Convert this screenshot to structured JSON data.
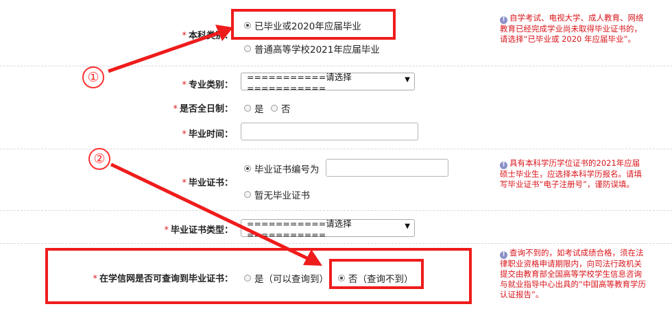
{
  "form": {
    "required_mark": "*",
    "rows": {
      "degree_type": {
        "label": "本科类别：",
        "options": [
          "已毕业或2020年应届毕业",
          "普通高等学校2021年应届毕业"
        ],
        "selected_index": 0,
        "hint": "自学考试、电视大学、成人教育、网络教育已经完成学业尚未取得毕业证书的，请选择“已毕业或 2020 年应届毕业”。"
      },
      "major_category": {
        "label": "专业类别：",
        "select_value": "===========请选择==========="
      },
      "full_time": {
        "label": "是否全日制：",
        "options": [
          "是",
          "否"
        ]
      },
      "graduation_time": {
        "label": "毕业时间：",
        "value": ""
      },
      "diploma": {
        "label": "毕业证书：",
        "options": [
          "毕业证书编号为",
          "暂无毕业证书"
        ],
        "selected_index": 0,
        "number_value": "",
        "hint": "具有本科学历学位证书的2021年应届硕士毕业生，应选择本科学历报名。请填写毕业证书“电子注册号”，谨防误填。"
      },
      "diploma_type": {
        "label": "毕业证书类型：",
        "select_value": "===========请选择==========="
      },
      "chsi_query": {
        "label": "在学信网是否可查询到毕业证书：",
        "options": [
          "是（可以查询到）",
          "否（查询不到）"
        ],
        "selected_index": 1,
        "hint": "查询不到的，如考试成绩合格，须在法律职业资格申请期限内，向司法行政机关提交由教育部全国高等学校学生信息咨询与就业指导中心出具的“中国高等教育学历认证报告”。"
      }
    }
  },
  "annotations": {
    "marker_1": "①",
    "marker_2": "②",
    "color": "#ef1c1c"
  },
  "icons": {
    "info": "info-icon",
    "dropdown": "chevron-down-icon"
  }
}
